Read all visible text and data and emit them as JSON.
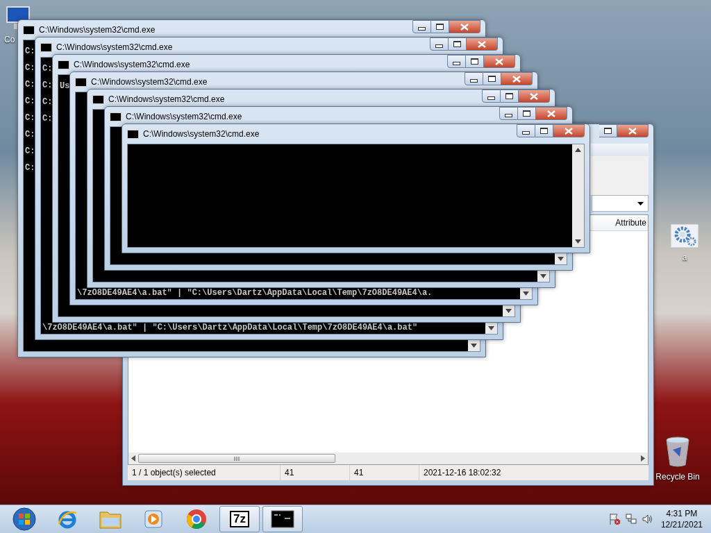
{
  "desktop_icons": [
    {
      "kind": "computer",
      "label": "Co"
    },
    {
      "kind": "settings-file",
      "label": "a"
    },
    {
      "kind": "recycle-bin",
      "label": "Recycle Bin"
    }
  ],
  "archive_window": {
    "column_header": "Attribute",
    "status_bar": [
      "1 / 1 object(s) selected",
      "41",
      "41",
      "2021-12-16 18:02:32"
    ]
  },
  "console_windows": [
    {
      "title": "C:\\Windows\\system32\\cmd.exe",
      "lines": [
        "C:",
        "C:",
        "C:",
        "C:",
        "C:",
        "C:",
        "C:",
        "C:"
      ]
    },
    {
      "title": "C:\\Windows\\system32\\cmd.exe",
      "lines": [
        "C:",
        "C:",
        "C:",
        "C:"
      ],
      "bottom_lines": [
        "\\7zO8DE49AE4\\a.bat\" | \"C:\\Users\\Dartz\\AppData\\Local\\Temp\\7zO8DE49AE4\\a.bat\""
      ]
    },
    {
      "title": "C:\\Windows\\system32\\cmd.exe",
      "lines": [
        "Us"
      ]
    },
    {
      "title": "C:\\Windows\\system32\\cmd.exe",
      "bottom_lines": [
        "\\7zO8DE49AE4\\a.bat\" | \"C:\\Users\\Dartz\\AppData\\Local\\Temp\\7zO8DE49AE4\\a."
      ]
    },
    {
      "title": "C:\\Windows\\system32\\cmd.exe"
    },
    {
      "title": "C:\\Windows\\system32\\cmd.exe"
    },
    {
      "title": "C:\\Windows\\system32\\cmd.exe"
    }
  ],
  "taskbar": {
    "items": [
      {
        "kind": "start",
        "running": false
      },
      {
        "kind": "browser-e",
        "running": false
      },
      {
        "kind": "folder",
        "running": false
      },
      {
        "kind": "media",
        "running": false
      },
      {
        "kind": "browser-ball",
        "running": false
      },
      {
        "kind": "archiver",
        "label": "7z",
        "running": true
      },
      {
        "kind": "console",
        "running": true
      }
    ],
    "tray": [
      {
        "kind": "flag"
      },
      {
        "kind": "network"
      },
      {
        "kind": "volume"
      }
    ],
    "clock": {
      "time": "4:31 PM",
      "date": "12/21/2021"
    }
  }
}
